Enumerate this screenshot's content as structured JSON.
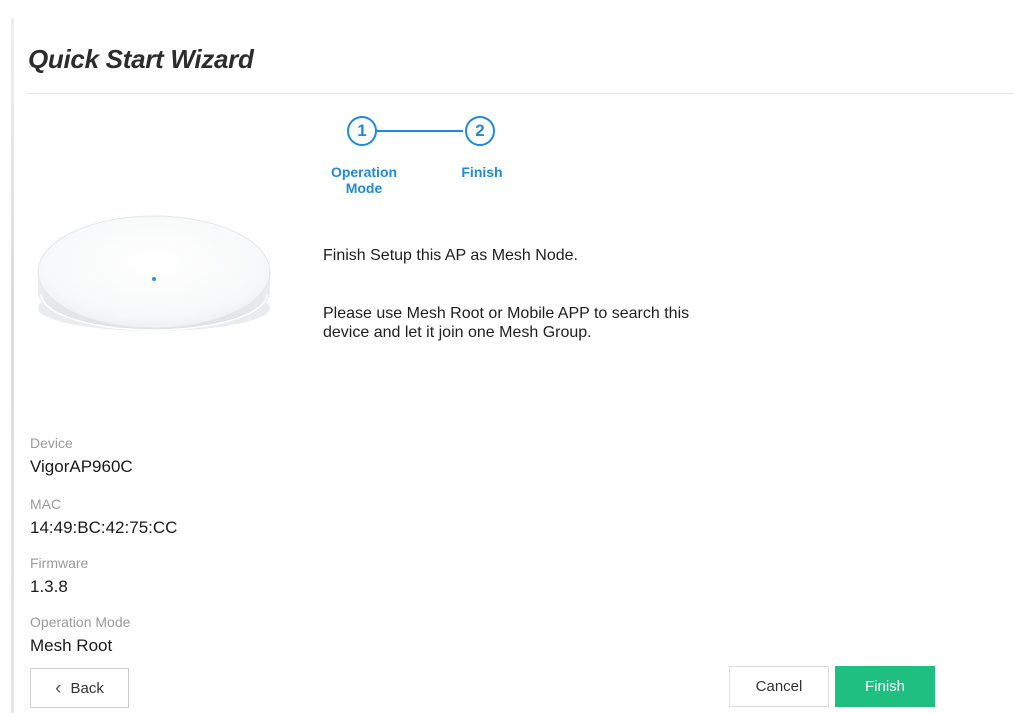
{
  "page": {
    "title": "Quick Start Wizard"
  },
  "stepper": {
    "steps": [
      {
        "number": "1",
        "label_line1": "Operation",
        "label_line2": "Mode"
      },
      {
        "number": "2",
        "label_line1": "Finish",
        "label_line2": ""
      }
    ]
  },
  "message": {
    "finish": "Finish Setup this AP as Mesh Node.",
    "instructions_line1": "Please use Mesh Root or Mobile APP to search this",
    "instructions_line2": "device and let it join one Mesh Group."
  },
  "device_info": {
    "device_label": "Device",
    "device_value": "VigorAP960C",
    "mac_label": "MAC",
    "mac_value": "14:49:BC:42:75:CC",
    "firmware_label": "Firmware",
    "firmware_value": "1.3.8",
    "operation_mode_label": "Operation Mode",
    "operation_mode_value": "Mesh Root"
  },
  "buttons": {
    "back": "Back",
    "cancel": "Cancel",
    "finish": "Finish"
  },
  "icons": {
    "back": "chevron-left-icon",
    "device": "access-point-device-image"
  },
  "colors": {
    "accent": "#1f8ad9",
    "finish_button": "#1fbf7f"
  }
}
